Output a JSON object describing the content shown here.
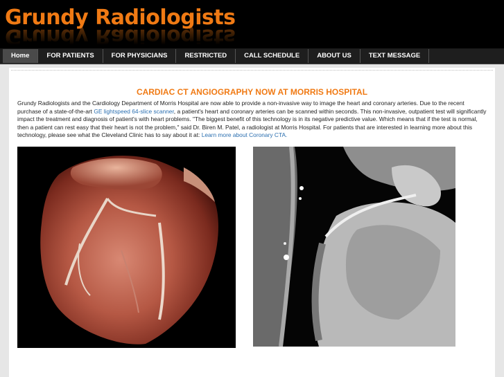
{
  "header": {
    "logo_text": "Grundy Radiologists"
  },
  "nav": {
    "items": [
      {
        "label": "Home",
        "active": true
      },
      {
        "label": "FOR PATIENTS",
        "active": false
      },
      {
        "label": "FOR PHYSICIANS",
        "active": false
      },
      {
        "label": "RESTRICTED",
        "active": false
      },
      {
        "label": "CALL SCHEDULE",
        "active": false
      },
      {
        "label": "ABOUT US",
        "active": false
      },
      {
        "label": "TEXT MESSAGE",
        "active": false
      }
    ]
  },
  "article": {
    "headline": "CARDIAC CT ANGIOGRAPHY NOW AT MORRIS HOSPITAL",
    "para_part1": "Grundy Radiologists and the Cardiology Department of Morris Hospital are now able to provide a non-invasive way to image the heart and coronary arteries. Due to the recent purchase of a state-of-the-art ",
    "link_scanner": "GE lightspeed 64-slice scanner",
    "para_part2": ", a patient's heart and coronary arteries can be scanned within seconds. This non-invasive, outpatient test will significantly impact the treatment and diagnosis of patient's with heart problems. \"The biggest benefit of this technology is in its negative predictive value. Which means that if the test is normal, then a patient can rest easy that their heart is not the problem,\" said Dr. Biren M. Patel, a radiologist at Morris Hospital. For patients that are interested in learning more about this technology, please see what the Cleveland Clinic has to say about it at: ",
    "link_learn": "Learn more about Coronary CTA."
  },
  "colors": {
    "accent": "#f07a14",
    "link": "#2b6fb0",
    "nav_bg": "#1e1e1e",
    "nav_active": "#4a4a4a"
  }
}
